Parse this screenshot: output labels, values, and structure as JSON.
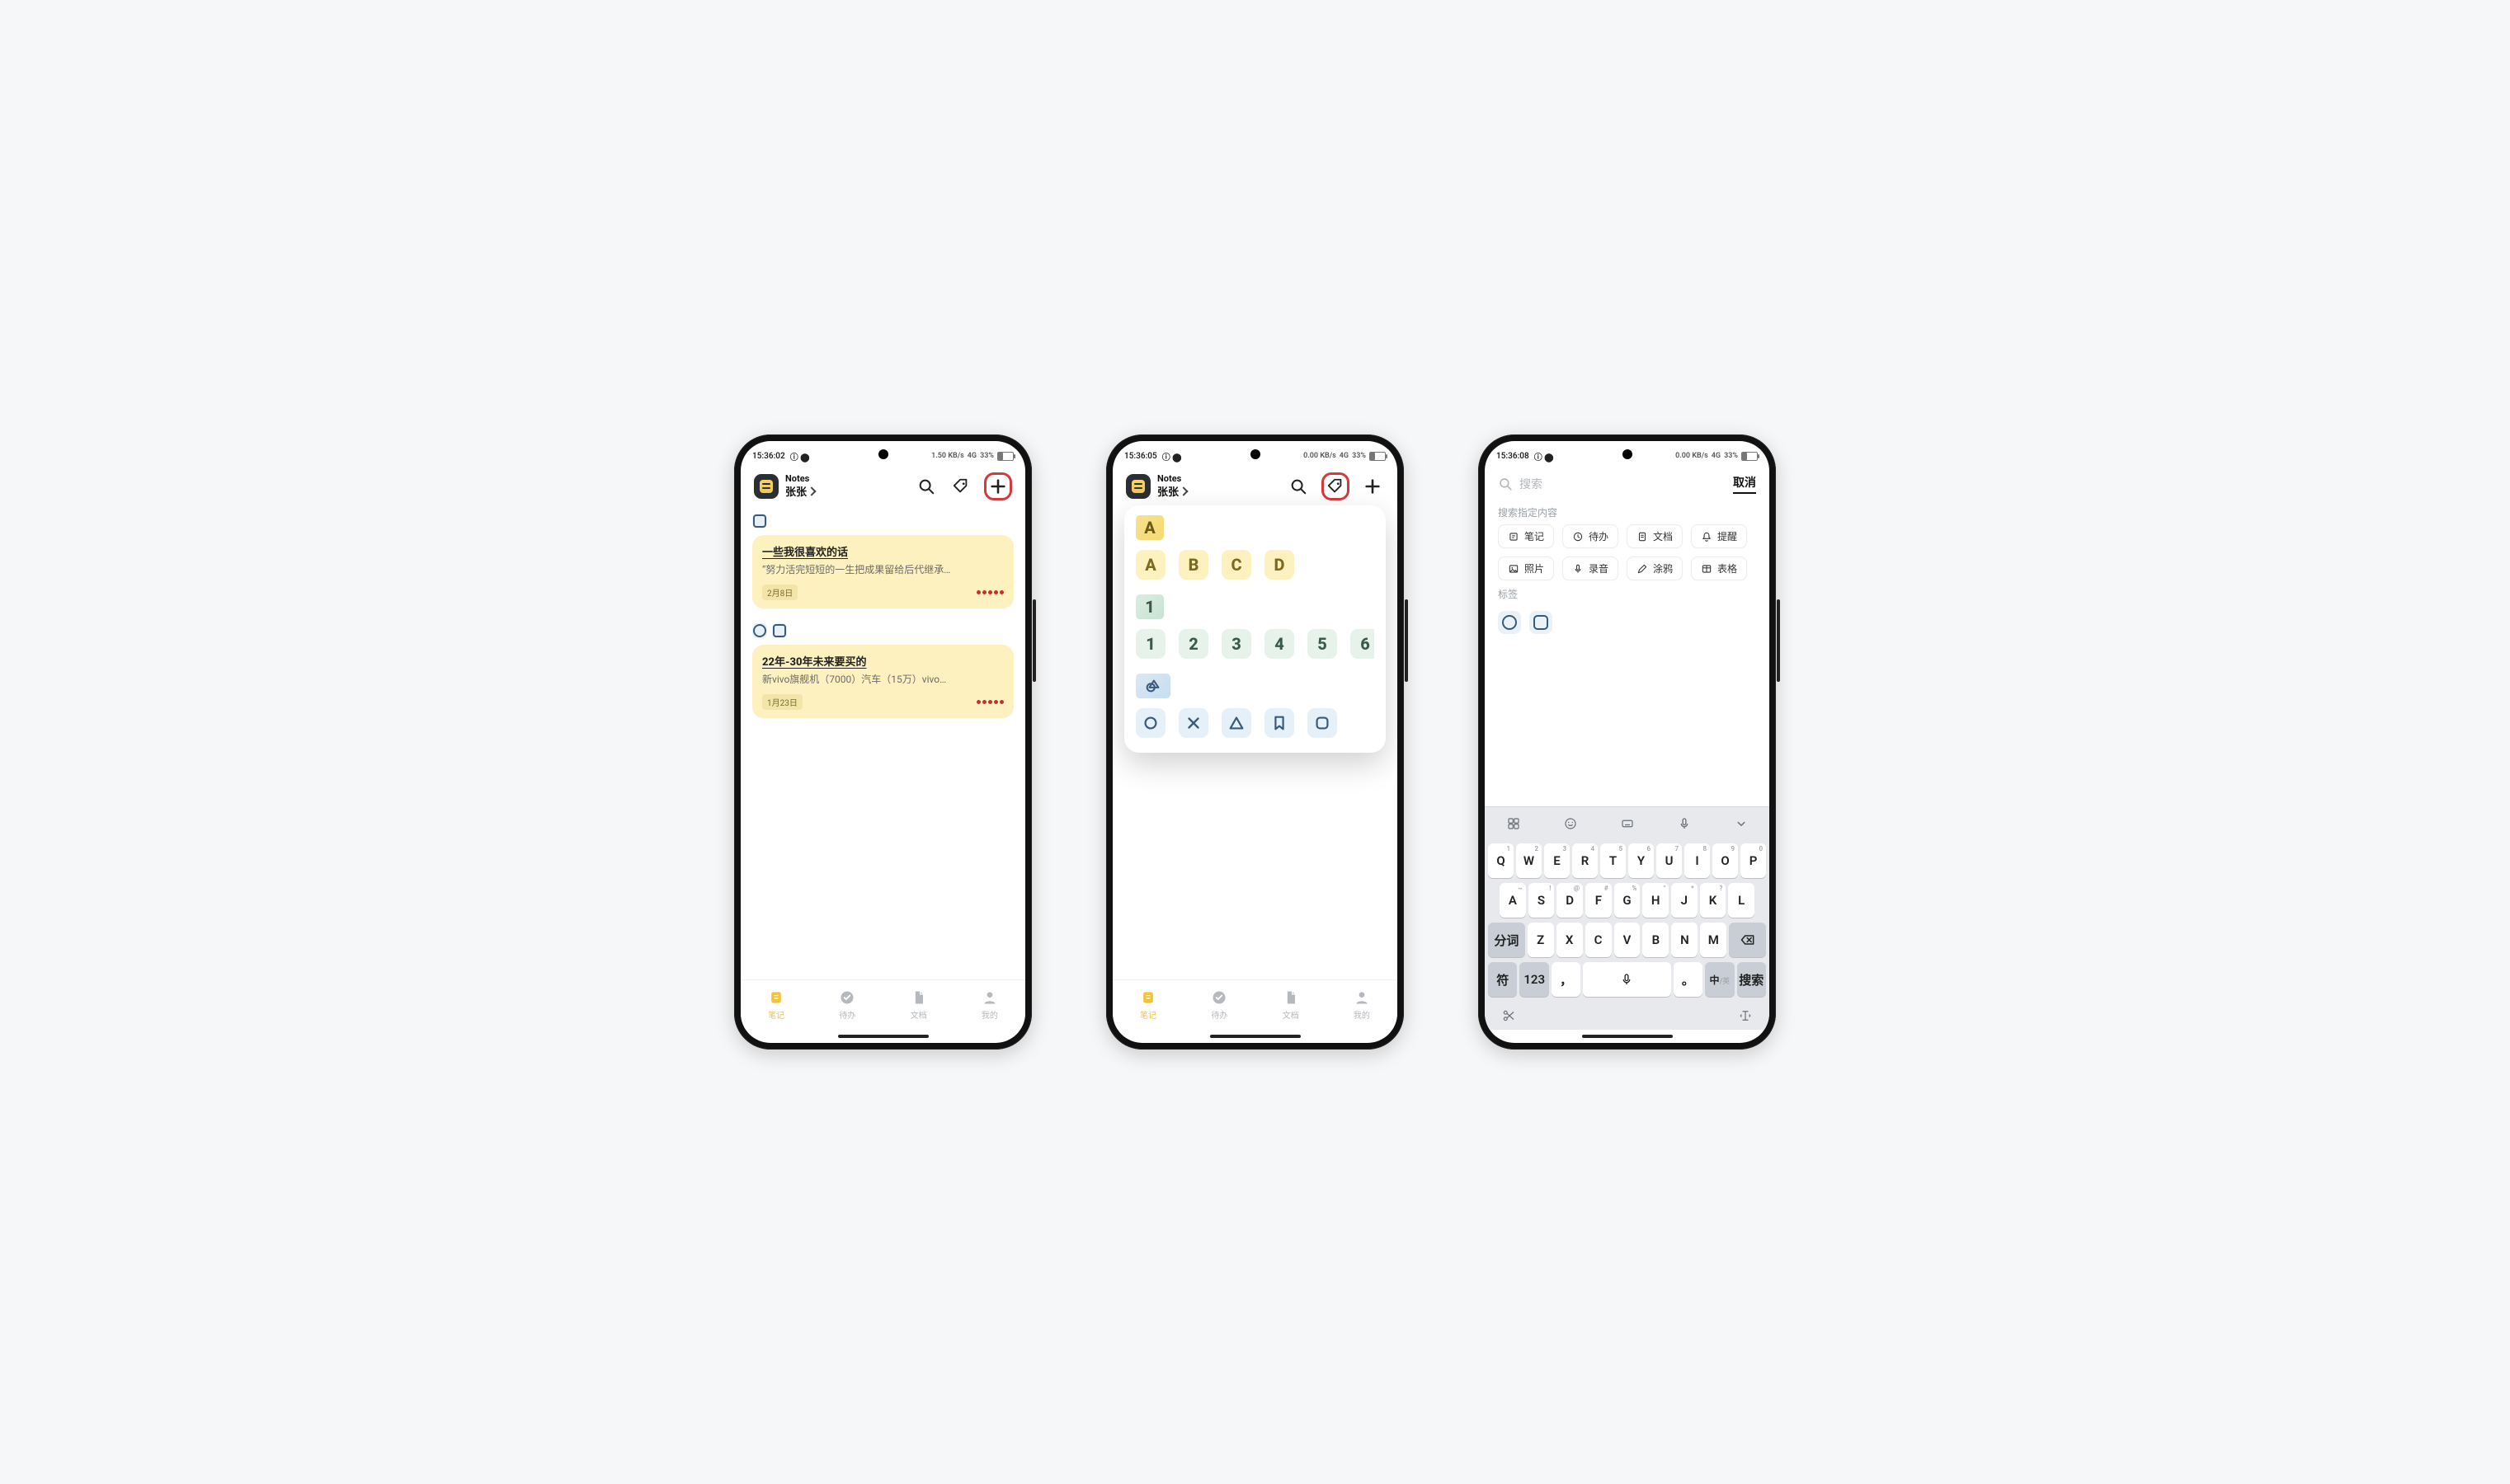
{
  "status": {
    "times": [
      "15:36:02",
      "15:36:05",
      "15:36:08"
    ],
    "battery_pct": "33%",
    "signal_label": "4G",
    "kb_label_1": "1.50 KB/s",
    "kb_label_2": "0.00 KB/s"
  },
  "header": {
    "app_name": "Notes",
    "account": "张张"
  },
  "screen1": {
    "notes": [
      {
        "tag_shape": "square",
        "title": "一些我很喜欢的话",
        "body": "“努力活完短短的一生把成果留给后代继承…",
        "date": "2月8日",
        "priority_dots": 5
      },
      {
        "tag_shapes": [
          "circle",
          "square"
        ],
        "title": "22年-30年未来要买的",
        "body": "新vivo旗舰机（7000）汽车（15万）vivo…",
        "date": "1月23日",
        "priority_dots": 5
      }
    ]
  },
  "screen2": {
    "sections": [
      {
        "lead": "A",
        "style": "y",
        "items": [
          "A",
          "B",
          "C",
          "D"
        ]
      },
      {
        "lead": "1",
        "style": "g",
        "items": [
          "1",
          "2",
          "3",
          "4",
          "5",
          "6"
        ]
      },
      {
        "lead_shape": "mixed",
        "style": "b",
        "shapes": [
          "circle",
          "x",
          "triangle",
          "bookmark",
          "rounded-square"
        ]
      }
    ]
  },
  "screen3": {
    "search_placeholder": "搜索",
    "cancel": "取消",
    "section_title": "搜索指定内容",
    "chips": [
      {
        "icon": "note",
        "label": "笔记"
      },
      {
        "icon": "clock",
        "label": "待办"
      },
      {
        "icon": "doc",
        "label": "文档"
      },
      {
        "icon": "bell",
        "label": "提醒"
      },
      {
        "icon": "photo",
        "label": "照片"
      },
      {
        "icon": "mic",
        "label": "录音"
      },
      {
        "icon": "pen",
        "label": "涂鸦"
      },
      {
        "icon": "table",
        "label": "表格"
      }
    ],
    "tag_section_title": "标签"
  },
  "nav": {
    "items": [
      {
        "icon": "note",
        "label": "笔记",
        "active": true
      },
      {
        "icon": "check",
        "label": "待办"
      },
      {
        "icon": "doc",
        "label": "文档"
      },
      {
        "icon": "person",
        "label": "我的"
      }
    ]
  },
  "keyboard": {
    "row1": [
      [
        "Q",
        "1"
      ],
      [
        "W",
        "2"
      ],
      [
        "E",
        "3"
      ],
      [
        "R",
        "4"
      ],
      [
        "T",
        "5"
      ],
      [
        "Y",
        "6"
      ],
      [
        "U",
        "7"
      ],
      [
        "I",
        "8"
      ],
      [
        "O",
        "9"
      ],
      [
        "P",
        "0"
      ]
    ],
    "row2": [
      [
        "A",
        "~"
      ],
      [
        "S",
        "!"
      ],
      [
        "D",
        "@"
      ],
      [
        "F",
        "#"
      ],
      [
        "G",
        "%"
      ],
      [
        "H",
        "\""
      ],
      [
        "J",
        "*"
      ],
      [
        "K",
        "?"
      ],
      [
        "L",
        ""
      ]
    ],
    "row3_center": [
      "Z",
      "X",
      "C",
      "V",
      "B",
      "N",
      "M"
    ],
    "row3_left": "分词",
    "row4": {
      "sym": "符",
      "num": "123",
      "comma": "，",
      "period": "。",
      "lang": "中/英",
      "search": "搜索"
    }
  }
}
